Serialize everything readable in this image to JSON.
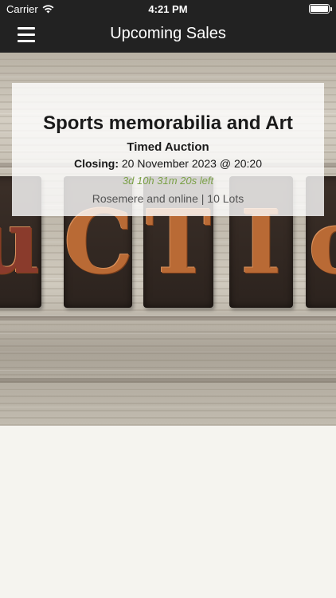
{
  "status_bar": {
    "carrier": "Carrier",
    "time": "4:21 PM"
  },
  "nav": {
    "title": "Upcoming Sales",
    "menu_icon": "hamburger-menu-icon"
  },
  "hero": {
    "letters": [
      "u",
      "C",
      "T",
      "I",
      "o"
    ]
  },
  "sale": {
    "title": "Sports memorabilia and Art",
    "type": "Timed Auction",
    "closing_label": "Closing:",
    "closing_value": " 20 November 2023 @ 20:20",
    "countdown": "3d 10h 31m 20s left",
    "location": "Rosemere and online | 10 Lots"
  },
  "colors": {
    "bar_background": "#222222",
    "countdown": "#7aa046",
    "page_background": "#f5f4ef"
  }
}
